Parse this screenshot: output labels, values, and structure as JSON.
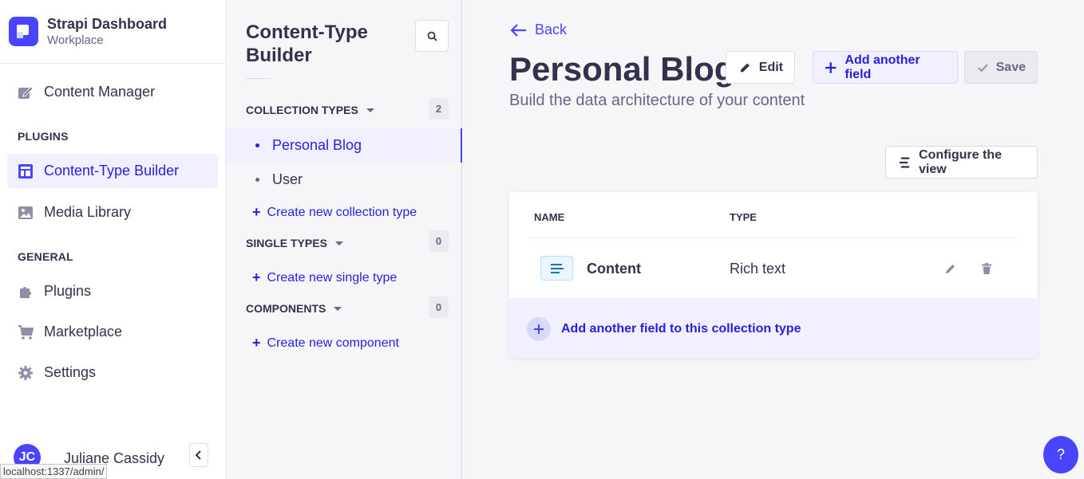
{
  "brand": {
    "title": "Strapi Dashboard",
    "subtitle": "Workplace"
  },
  "mainnav": {
    "content_manager": "Content Manager",
    "plugins_section": "PLUGINS",
    "content_type_builder": "Content-Type Builder",
    "media_library": "Media Library",
    "general_section": "GENERAL",
    "plugins": "Plugins",
    "marketplace": "Marketplace",
    "settings": "Settings"
  },
  "user": {
    "initials": "JC",
    "name": "Juliane Cassidy"
  },
  "status_url": "localhost:1337/admin/",
  "subnav": {
    "title_line1": "Content-Type",
    "title_line2": "Builder",
    "collection_types": {
      "label": "COLLECTION TYPES",
      "count": "2",
      "items": [
        "Personal Blog",
        "User"
      ],
      "create": "Create new collection type"
    },
    "single_types": {
      "label": "SINGLE TYPES",
      "count": "0",
      "create": "Create new single type"
    },
    "components": {
      "label": "COMPONENTS",
      "count": "0",
      "create": "Create new component"
    }
  },
  "main": {
    "back": "Back",
    "title": "Personal Blog",
    "subtitle": "Build the data architecture of your content",
    "edit": "Edit",
    "add_field": "Add another field",
    "save": "Save",
    "configure": "Configure the view",
    "table": {
      "headers": [
        "NAME",
        "TYPE"
      ],
      "rows": [
        {
          "name": "Content",
          "type": "Rich text"
        }
      ]
    },
    "add_field_collection": "Add another field to this collection type"
  },
  "help": "?",
  "colors": {
    "primary": "#4945ff",
    "primary_light": "#f0f0ff",
    "text": "#32324d",
    "muted": "#666687"
  }
}
